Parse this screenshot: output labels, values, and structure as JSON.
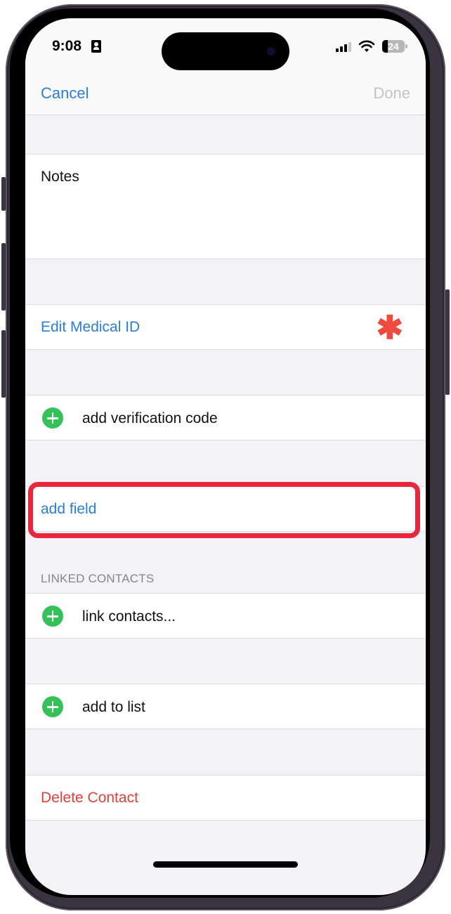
{
  "status_bar": {
    "time": "9:08",
    "battery_level": "24",
    "battery_fraction": 0.24,
    "icons": [
      "contact-card-icon",
      "signal-icon",
      "wifi-icon",
      "battery-icon"
    ]
  },
  "nav": {
    "cancel_label": "Cancel",
    "done_label": "Done"
  },
  "notes": {
    "label": "Notes"
  },
  "medical_id": {
    "label": "Edit Medical ID",
    "icon": "medical-asterisk-icon",
    "icon_glyph": "✱"
  },
  "verification": {
    "label": "add verification code"
  },
  "add_field": {
    "label": "add field",
    "highlighted": true
  },
  "linked_contacts": {
    "header": "LINKED CONTACTS",
    "action_label": "link contacts..."
  },
  "lists": {
    "action_label": "add to list"
  },
  "delete": {
    "label": "Delete Contact"
  },
  "colors": {
    "accent_blue": "#2a7fd4",
    "destructive_red": "#e0403a",
    "add_green": "#34c15a",
    "highlight_red": "#e8263d",
    "grouped_background": "#f2f2f7"
  }
}
